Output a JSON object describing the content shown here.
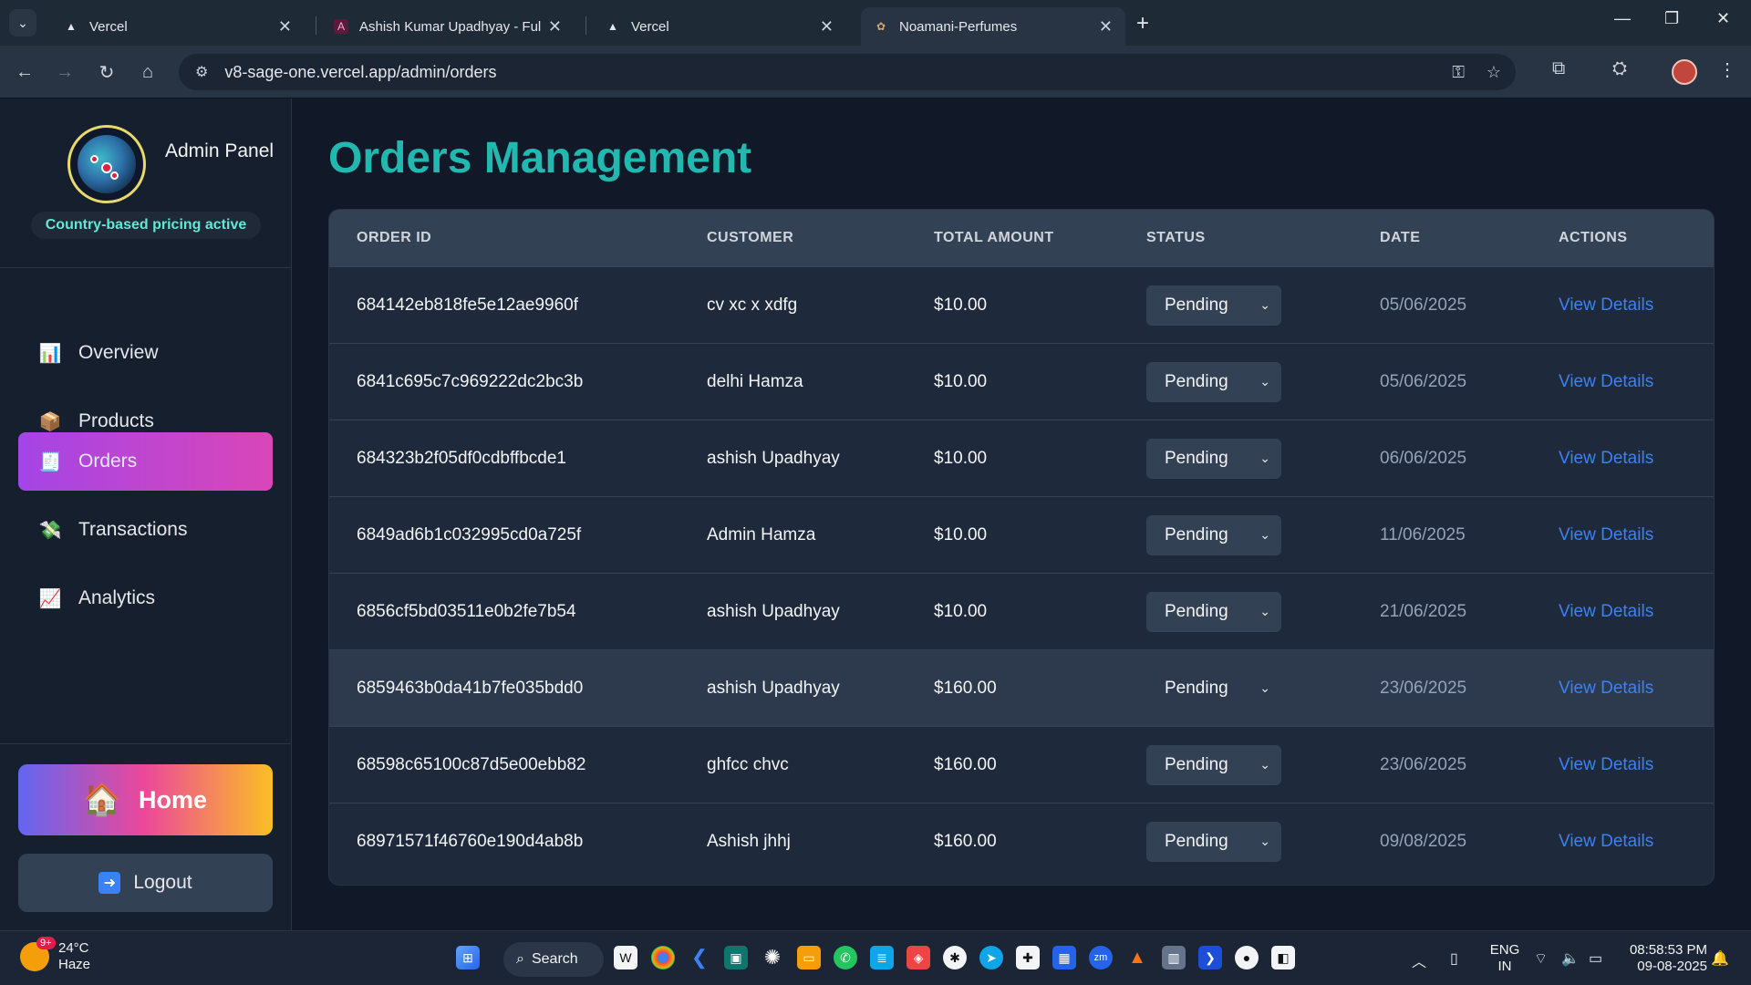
{
  "browser": {
    "tabs": [
      {
        "title": "Vercel",
        "favicon": "vercel-icon",
        "active": false
      },
      {
        "title": "Ashish Kumar Upadhyay - Full S",
        "favicon": "portfolio-icon",
        "active": false
      },
      {
        "title": "Vercel",
        "favicon": "vercel-icon",
        "active": false
      },
      {
        "title": "Noamani-Perfumes",
        "favicon": "perfume-icon",
        "active": true
      }
    ],
    "url": "v8-sage-one.vercel.app/admin/orders"
  },
  "sidebar": {
    "panel_title": "Admin Panel",
    "pricing_badge": "Country-based pricing active",
    "items": [
      {
        "label": "Overview",
        "icon": "bar-chart-icon",
        "active": false
      },
      {
        "label": "Products",
        "icon": "package-icon",
        "active": false
      },
      {
        "label": "Orders",
        "icon": "receipt-icon",
        "active": true
      },
      {
        "label": "Transactions",
        "icon": "money-icon",
        "active": false
      },
      {
        "label": "Analytics",
        "icon": "chart-icon",
        "active": false
      }
    ],
    "home_label": "Home",
    "logout_label": "Logout"
  },
  "main": {
    "title": "Orders Management",
    "table": {
      "headers": [
        "ORDER ID",
        "CUSTOMER",
        "TOTAL AMOUNT",
        "STATUS",
        "DATE",
        "ACTIONS"
      ],
      "rows": [
        {
          "order_id": "684142eb818fe5e12ae9960f",
          "customer": "cv xc x xdfg",
          "amount": "$10.00",
          "status": "Pending",
          "date": "05/06/2025",
          "action": "View Details"
        },
        {
          "order_id": "6841c695c7c969222dc2bc3b",
          "customer": "delhi Hamza",
          "amount": "$10.00",
          "status": "Pending",
          "date": "05/06/2025",
          "action": "View Details"
        },
        {
          "order_id": "684323b2f05df0cdbffbcde1",
          "customer": "ashish Upadhyay",
          "amount": "$10.00",
          "status": "Pending",
          "date": "06/06/2025",
          "action": "View Details"
        },
        {
          "order_id": "6849ad6b1c032995cd0a725f",
          "customer": "Admin Hamza",
          "amount": "$10.00",
          "status": "Pending",
          "date": "11/06/2025",
          "action": "View Details"
        },
        {
          "order_id": "6856cf5bd03511e0b2fe7b54",
          "customer": "ashish Upadhyay",
          "amount": "$10.00",
          "status": "Pending",
          "date": "21/06/2025",
          "action": "View Details"
        },
        {
          "order_id": "6859463b0da41b7fe035bdd0",
          "customer": "ashish Upadhyay",
          "amount": "$160.00",
          "status": "Pending",
          "date": "23/06/2025",
          "action": "View Details"
        },
        {
          "order_id": "68598c65100c87d5e00ebb82",
          "customer": "ghfcc chvc",
          "amount": "$160.00",
          "status": "Pending",
          "date": "23/06/2025",
          "action": "View Details"
        },
        {
          "order_id": "68971571f46760e190d4ab8b",
          "customer": "Ashish jhhj",
          "amount": "$160.00",
          "status": "Pending",
          "date": "09/08/2025",
          "action": "View Details"
        }
      ]
    }
  },
  "taskbar": {
    "weather_temp": "24°C",
    "weather_desc": "Haze",
    "weather_badge": "9+",
    "search_label": "Search",
    "lang_top": "ENG",
    "lang_bottom": "IN",
    "time": "08:58:53 PM",
    "date": "09-08-2025"
  },
  "colors": {
    "accent_teal": "#22b8b0",
    "active_nav": "#a445e6",
    "link_blue": "#3b82f6"
  }
}
